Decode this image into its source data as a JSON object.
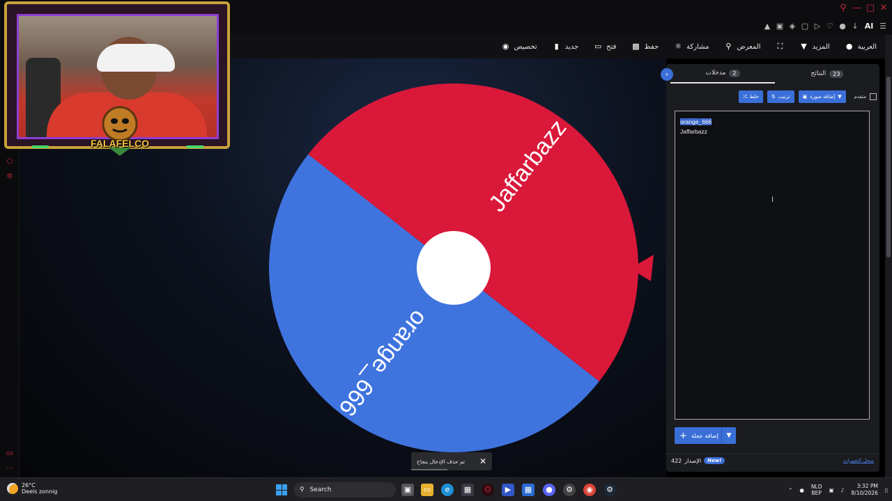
{
  "navbar": {
    "items": [
      {
        "key": "language",
        "label": "العربية",
        "icon": "globe-icon"
      },
      {
        "key": "more",
        "label": "المزيد",
        "icon": "caret-down-icon"
      },
      {
        "key": "fullscreen",
        "label": "",
        "icon": "fullscreen-icon"
      },
      {
        "key": "gallery",
        "label": "المعرض",
        "icon": "search-icon"
      },
      {
        "key": "share",
        "label": "مشاركة",
        "icon": "share-icon"
      },
      {
        "key": "save",
        "label": "حفظ",
        "icon": "save-icon"
      },
      {
        "key": "open",
        "label": "فتح",
        "icon": "folder-icon"
      },
      {
        "key": "new",
        "label": "جديد",
        "icon": "file-icon"
      },
      {
        "key": "customize",
        "label": "تخصيص",
        "icon": "palette-icon"
      }
    ]
  },
  "browser": {
    "ai_label": "AI"
  },
  "wheel": {
    "segments": [
      {
        "label": "Jaffarbazz",
        "color": "#d9183a"
      },
      {
        "label": "orange_666",
        "color": "#3f74df"
      }
    ],
    "center_color": "#ffffff",
    "pointer_color": "#d9183a"
  },
  "webcam": {
    "badge_text": "FALAFELCO"
  },
  "panel": {
    "tabs": [
      {
        "label": "مدخلات",
        "count": "2",
        "active": true
      },
      {
        "label": "النتائج",
        "count": "23",
        "active": false
      }
    ],
    "toolbar": {
      "shuffle_label": "خلط",
      "sort_label": "ترتيب",
      "add_image_label": "إضافة صورة",
      "advanced_label": "متقدم"
    },
    "entries": [
      "orange_666",
      "Jaffarbazz"
    ],
    "add_wheel_label": "إضافة عجلة",
    "version_label": "الإصدار",
    "version_number": "422",
    "new_badge": "New!",
    "changelog_label": "سجل التغييرات"
  },
  "toast": {
    "message": "تم حذف الإدخال بنجاح"
  },
  "taskbar": {
    "weather_temp": "26°C",
    "weather_desc": "Deels zonnig",
    "search_placeholder": "Search",
    "lang_top": "NLD",
    "lang_bottom": "BEP",
    "time": "3:32 PM",
    "date": "8/10/2026"
  }
}
